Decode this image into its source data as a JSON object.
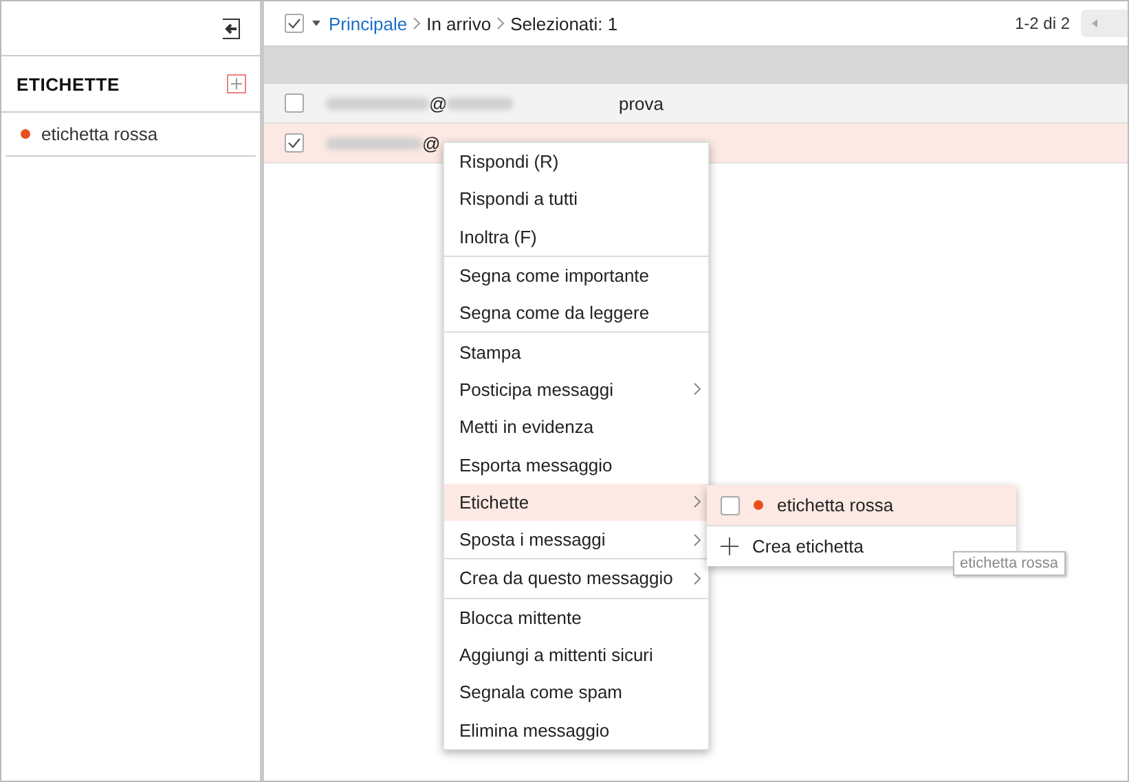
{
  "sidebar": {
    "section_title": "ETICHETTE",
    "labels": [
      {
        "name": "etichetta rossa",
        "color": "#e8501e"
      }
    ]
  },
  "toolbar": {
    "select_all_checked": true,
    "breadcrumb": [
      {
        "label": "Principale",
        "link": true
      },
      {
        "label": "In arrivo",
        "link": false
      },
      {
        "label": "Selezionati: 1",
        "link": false
      }
    ],
    "pagination": "1-2 di 2"
  },
  "messages": [
    {
      "sender": "@",
      "subject": "prova",
      "checked": false,
      "selected": false
    },
    {
      "sender": "@",
      "checked": true,
      "selected": true
    }
  ],
  "context_menu": {
    "groups": [
      [
        {
          "label": "Rispondi (R)",
          "submenu": false,
          "selected": false
        },
        {
          "label": "Rispondi a tutti",
          "submenu": false,
          "selected": false
        },
        {
          "label": "Inoltra (F)",
          "submenu": false,
          "selected": false
        }
      ],
      [
        {
          "label": "Segna come importante",
          "submenu": false,
          "selected": false
        },
        {
          "label": "Segna come da leggere",
          "submenu": false,
          "selected": false
        }
      ],
      [
        {
          "label": "Stampa",
          "submenu": false,
          "selected": false
        },
        {
          "label": "Posticipa messaggi",
          "submenu": true,
          "selected": false
        },
        {
          "label": "Metti in evidenza",
          "submenu": false,
          "selected": false
        },
        {
          "label": "Esporta messaggio",
          "submenu": false,
          "selected": false
        },
        {
          "label": "Etichette",
          "submenu": true,
          "selected": true
        },
        {
          "label": "Sposta i messaggi",
          "submenu": true,
          "selected": false
        }
      ],
      [
        {
          "label": "Crea da questo messaggio",
          "submenu": true,
          "selected": false
        }
      ],
      [
        {
          "label": "Blocca mittente",
          "submenu": false,
          "selected": false
        },
        {
          "label": "Aggiungi a mittenti sicuri",
          "submenu": false,
          "selected": false
        },
        {
          "label": "Segnala come spam",
          "submenu": false,
          "selected": false
        },
        {
          "label": "Elimina messaggio",
          "submenu": false,
          "selected": false
        }
      ]
    ]
  },
  "submenu": {
    "items": [
      {
        "kind": "label",
        "label": "etichetta rossa",
        "color": "#e8501e",
        "checked": false,
        "selected": true
      },
      {
        "kind": "create",
        "label": "Crea etichetta",
        "selected": false
      }
    ]
  },
  "tooltip": "etichetta rossa"
}
